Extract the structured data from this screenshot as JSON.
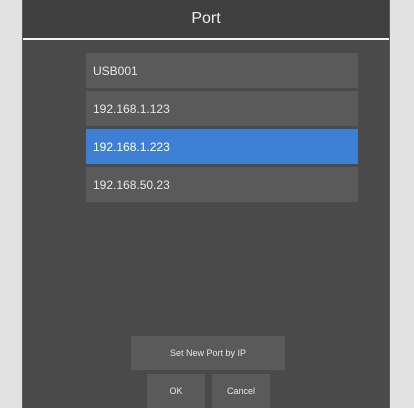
{
  "dialog": {
    "title": "Port"
  },
  "ports": {
    "items": [
      {
        "label": "USB001"
      },
      {
        "label": "192.168.1.123"
      },
      {
        "label": "192.168.1.223"
      },
      {
        "label": "192.168.50.23"
      }
    ],
    "selected_index": 2
  },
  "buttons": {
    "set_new_port_label": "Set New Port by IP",
    "ok_label": "OK",
    "cancel_label": "Cancel"
  },
  "colors": {
    "dialog_background": "#4a4a4a",
    "list_item_background": "#5a5a5a",
    "selected_item": "#3c7fd3"
  }
}
